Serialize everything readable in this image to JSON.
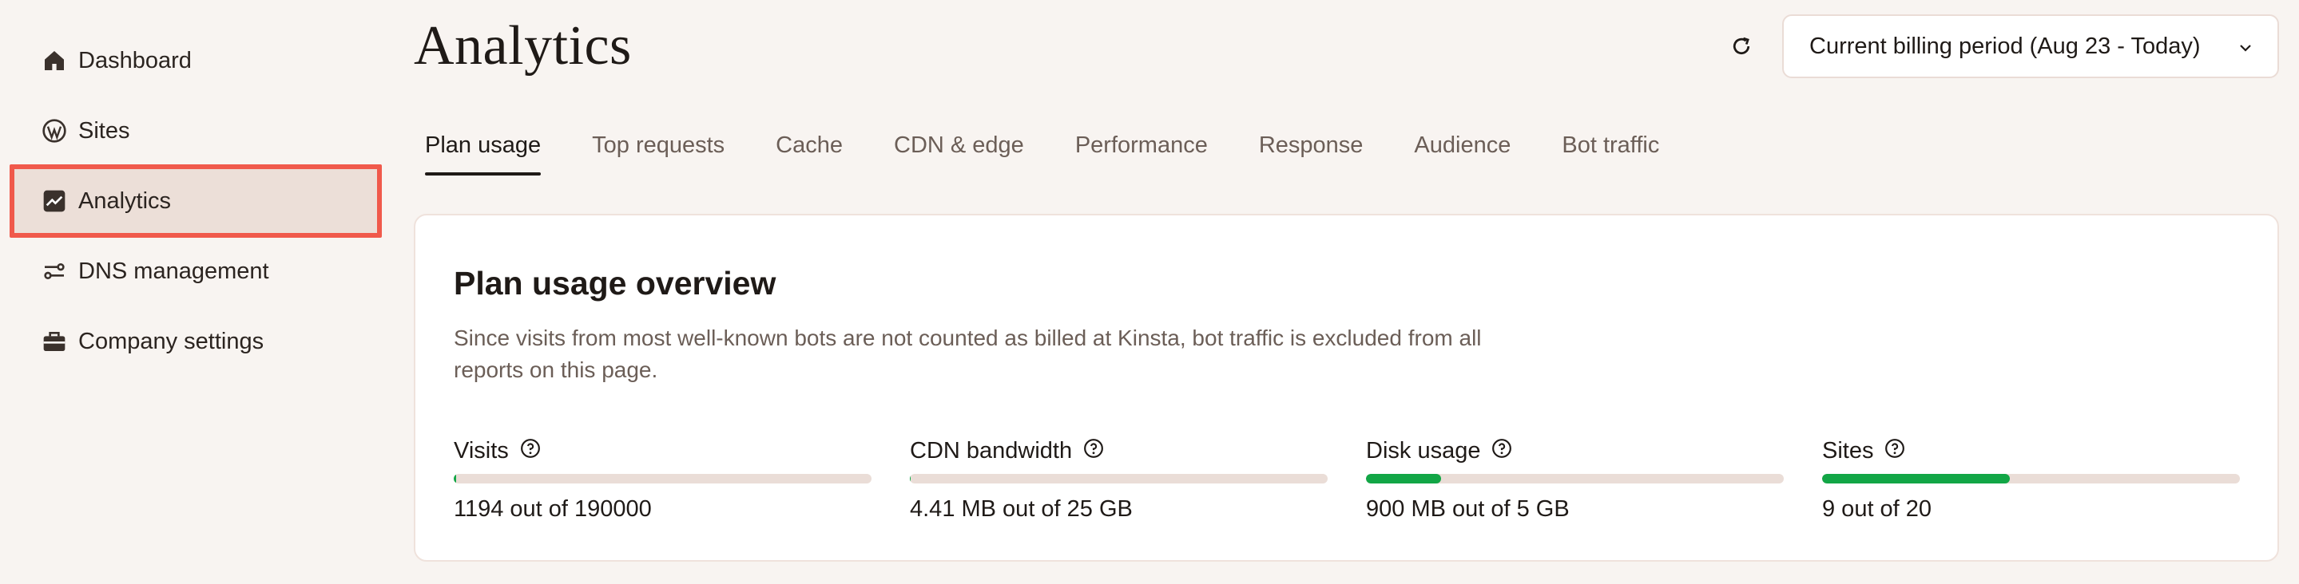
{
  "sidebar": {
    "items": [
      {
        "label": "Dashboard",
        "icon": "home-icon"
      },
      {
        "label": "Sites",
        "icon": "wordpress-icon"
      },
      {
        "label": "Analytics",
        "icon": "analytics-icon",
        "active": true
      },
      {
        "label": "DNS management",
        "icon": "dns-icon"
      },
      {
        "label": "Company settings",
        "icon": "briefcase-icon"
      }
    ]
  },
  "header": {
    "title": "Analytics",
    "period_select": "Current billing period (Aug 23 - Today)"
  },
  "tabs": [
    {
      "label": "Plan usage",
      "active": true
    },
    {
      "label": "Top requests"
    },
    {
      "label": "Cache"
    },
    {
      "label": "CDN & edge"
    },
    {
      "label": "Performance"
    },
    {
      "label": "Response"
    },
    {
      "label": "Audience"
    },
    {
      "label": "Bot traffic"
    }
  ],
  "card": {
    "title": "Plan usage overview",
    "description": "Since visits from most well-known bots are not counted as billed at Kinsta, bot traffic is excluded from all reports on this page.",
    "metrics": [
      {
        "label": "Visits",
        "value": "1194 out of 190000",
        "fraction": 0.006
      },
      {
        "label": "CDN bandwidth",
        "value": "4.41 MB out of 25 GB",
        "fraction": 0.002
      },
      {
        "label": "Disk usage",
        "value": "900 MB out of 5 GB",
        "fraction": 0.18
      },
      {
        "label": "Sites",
        "value": "9 out of 20",
        "fraction": 0.45
      }
    ]
  },
  "colors": {
    "accent_highlight": "#f0594b",
    "progress_fill": "#12a646",
    "progress_track": "#eaddd7",
    "background": "#f8f4f1"
  }
}
